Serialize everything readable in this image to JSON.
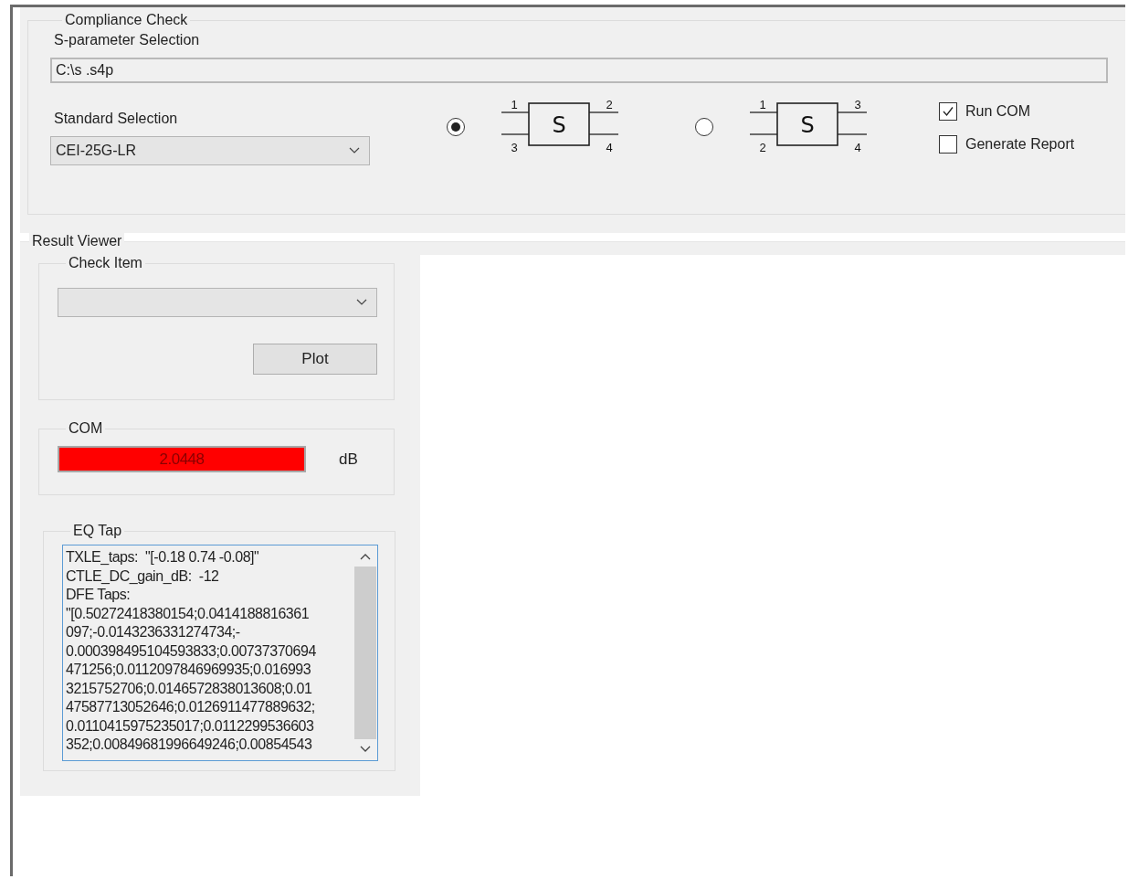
{
  "compliance_check": {
    "title": "Compliance Check",
    "s_parameter": {
      "label": "S-parameter Selection",
      "value": "C:\\s .s4p"
    },
    "standard": {
      "label": "Standard Selection",
      "value": "CEI-25G-LR"
    },
    "port_options": [
      {
        "selected": true,
        "box_label": "S",
        "ports": [
          "1",
          "2",
          "3",
          "4"
        ]
      },
      {
        "selected": false,
        "box_label": "S",
        "ports": [
          "1",
          "3",
          "2",
          "4"
        ]
      }
    ],
    "options": [
      {
        "label": "Run COM",
        "checked": true
      },
      {
        "label": "Generate Report",
        "checked": false
      }
    ]
  },
  "result_viewer": {
    "title": "Result Viewer",
    "check_item": {
      "title": "Check Item",
      "button": "Plot"
    },
    "com": {
      "title": "COM",
      "value": "2.0448",
      "unit": "dB",
      "pass": false
    },
    "eq_tap": {
      "title": "EQ Tap",
      "lines": [
        "TXLE_taps:  \"[-0.18 0.74 -0.08]\"",
        "CTLE_DC_gain_dB:  -12",
        "DFE Taps:",
        "\"[0.50272418380154;0.0414188816361",
        "097;-0.0143236331274734;-",
        "0.000398495104593833;0.00737370694",
        "471256;0.0112097846969935;0.016993",
        "3215752706;0.0146572838013608;0.01",
        "47587713052646;0.0126911477889632;",
        "0.0110415975235017;0.0112299536603",
        "352;0.00849681996649246;0.00854543"
      ]
    }
  }
}
